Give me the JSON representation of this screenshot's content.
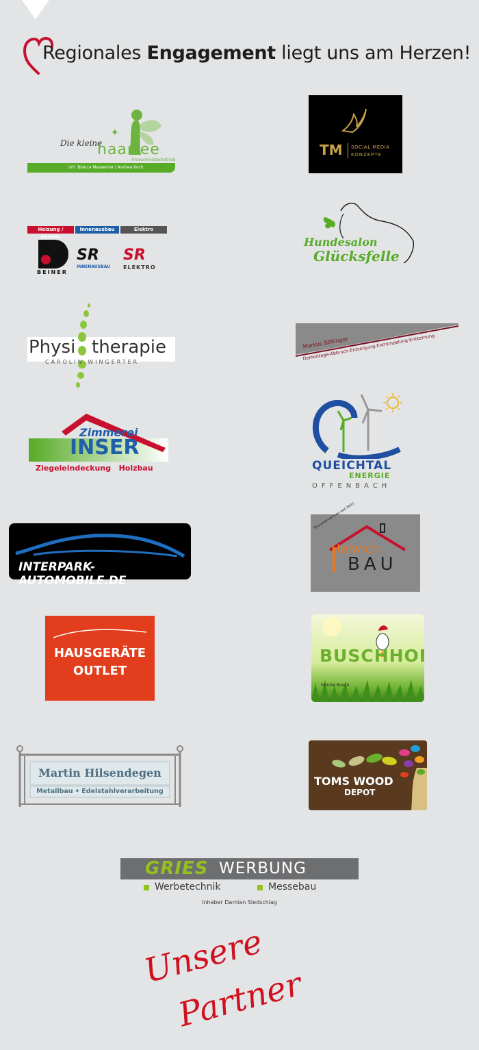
{
  "headline": {
    "pre": "Regionales ",
    "bold": "Engagement",
    "post": " liegt uns am Herzen!"
  },
  "logos": {
    "haarfee": {
      "script": "Die kleine",
      "name": "haarfee",
      "sub": "Friseurmeisterbetrieb",
      "owners": "Inh. Bianca Messemer | Andrea Koch"
    },
    "tm": {
      "mark": "TM",
      "l1": "SOCIAL MEDIA",
      "l2": "KONZEPTE"
    },
    "beiner": {
      "cat1": "Heizung / Sanitär",
      "cat2": "Innenausbau",
      "cat3": "Elektro",
      "inh": "Inh. S. Reuther",
      "name": "BEINER",
      "sr1": "SR",
      "sr1sub": "INNENAUSBAU",
      "sr2": "SR",
      "sr2sub": "ELEKTRO"
    },
    "hundesalon": {
      "l1": "Hundesalon",
      "l2": "Glücksfelle"
    },
    "physio": {
      "name1": "Physi",
      "name2": "therapie",
      "sub": "CAROLIN WINGERTER"
    },
    "boellinger": {
      "name": "Markus Böllinger",
      "services": "Demontage-Abbruch-Entsorgung-Entrümpelung-Entkernung"
    },
    "zimmerei": {
      "l1": "Zimmerei",
      "l2": "INSER",
      "l3": "Ziegeleindeckung   Holzbau"
    },
    "queichtal": {
      "l1": "QUEICHTAL",
      "l2": "ENERGIE",
      "l3": "OFFENBACH"
    },
    "interpark": {
      "name": "INTERPARK-AUTOMOBILE.DE"
    },
    "helwich": {
      "since": "Bauunternehmen seit 2007",
      "l1": "Helwich",
      "l2": "BAU"
    },
    "hausgeraete": {
      "l1": "HAUSGERÄTE",
      "l2": "OUTLET"
    },
    "buschhof": {
      "name": "BUSCHHOF",
      "family": "Familie Busch"
    },
    "hilsendegen": {
      "name": "Martin Hilsendegen",
      "sub": "Metallbau • Edelstahlverarbeitung"
    },
    "tomswood": {
      "l1": "TOMS WOOD",
      "l2": "DEPOT"
    },
    "gries": {
      "brand": "GRIES",
      "werbung": "WERBUNG",
      "b1": "Werbetechnik",
      "b2": "Messebau",
      "owner": "Inhaber Damian Siedschlag"
    }
  },
  "partner": {
    "l1": "Unsere",
    "l2": "Partner"
  },
  "colors": {
    "background": "#e3e4e6",
    "heart": "#c8102e",
    "partner": "#d0101e",
    "green": "#57ab27",
    "gries_green": "#95c11f"
  }
}
